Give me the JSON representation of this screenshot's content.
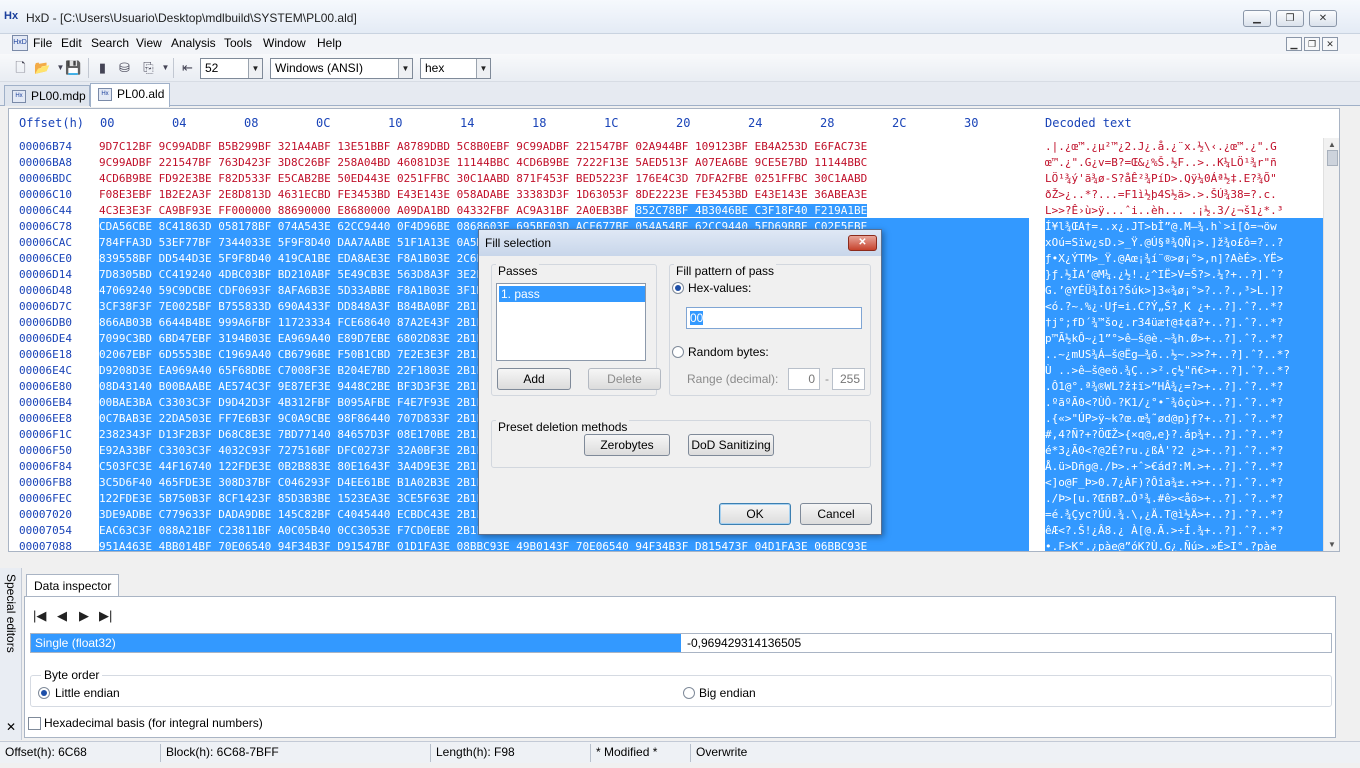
{
  "window": {
    "title": "HxD - [C:\\Users\\Usuario\\Desktop\\mdlbuild\\SYSTEM\\PL00.ald]",
    "icon_text": "Hx"
  },
  "menu": [
    "File",
    "Edit",
    "Search",
    "View",
    "Analysis",
    "Tools",
    "Window",
    "Help"
  ],
  "toolbar": {
    "bytes_per_row": "52",
    "charset": "Windows (ANSI)",
    "offset_base": "hex"
  },
  "tabs": [
    {
      "label": "PL00.mdp",
      "active": false
    },
    {
      "label": "PL00.ald",
      "active": true
    }
  ],
  "editor": {
    "offset_header": "Offset(h)",
    "columns": [
      "00",
      "04",
      "08",
      "0C",
      "10",
      "14",
      "18",
      "1C",
      "20",
      "24",
      "28",
      "2C",
      "30"
    ],
    "decoded_header": "Decoded text",
    "rows": [
      {
        "offset": "00006B74",
        "hex": "9D7C12BF 9C99ADBF B5B299BF 321A4ABF 13E51BBF A8789DBD 5C8B0EBF 9C99ADBF 221547BF 02A944BF 109123BF EB4A253D E6FAC73E",
        "text": ".|.¿œ™.¿µ²™¿2.J¿.å.¿¨x.½\\‹.¿œ™.¿\".G",
        "sel": "none"
      },
      {
        "offset": "00006BA8",
        "hex": "9C99ADBF 221547BF 763D423F 3D8C26BF 258A04BD 46081D3E 11144BBC 4CD6B9BE 7222F13E 5AED513F A07EA6BE 9CE5E7BD 11144BBC",
        "text": "œ™.¿\".G¿v=B?=Œ&¿%Š.½F..>..K¼LÖ¹¾r\"ñ",
        "sel": "none"
      },
      {
        "offset": "00006BDC",
        "hex": "4CD6B9BE FD92E3BE F82D533F E5CAB2BE 50ED443E 0251FFBC 30C1AABD 871F453F BED5223F 176E4C3D 7DFA2FBE 0251FFBC 30C1AABD",
        "text": "LÖ¹¾ý'ã¾ø-S?åÊ²¾PíD>.Qÿ¼0Áª½‡.E?¾Õ\"",
        "sel": "none"
      },
      {
        "offset": "00006C10",
        "hex": "F08E3EBF 1B2E2A3F 2E8D813D 4631ECBD FE3453BD E43E143E 058ADABE 33383D3F 1D63053F 8DE2223E FE3453BD E43E143E 36ABEA3E",
        "text": "ðŽ>¿..*?...=F1ì½þ4S½ä>.>.ŠÚ¾38=?.c.",
        "sel": "none"
      },
      {
        "offset": "00006C44",
        "hex": "4C3E3E3F CA9BF93E FF000000 88690000 E8680000 A09DA1BD 04332FBF AC9A31BF 2A0EB3BF 852C78BF 4B3046BE C3F18F40 F219A1BE",
        "text": "L>>?Ê›ù>ÿ...ˆi..èh... .¡½.3/¿¬š1¿*.³",
        "sel": "partial"
      },
      {
        "offset": "00006C78",
        "hex": "CDA56CBE 8C41863D 058178BF 074A543E 62CC9440 0F4D96BE 0868603E 695BF03D ACF677BF 054A54BE 62CC9440 5FD69BBE C02E5EBE",
        "text": "Í¥l¾ŒA†=..x¿.JT>bÌ”@.M–¾.h`>i[ð=¬öw",
        "sel": "full"
      },
      {
        "offset": "00006CAC",
        "hex": "784FFA3D 53EF77BF 7344033E 5F9F8D40 DAA7AABE 51F1A13E 0A5D9EBE 6FA3F43D 3F1B2E3F 0A82B33E 2B1F8D3F F54F08BF CBC2D9BC",
        "text": "xOú=Sïw¿sD.>_Ÿ.@Ú§ª¾QÑ¡>.]ž¾o£ô=?..?",
        "sel": "full"
      },
      {
        "offset": "00006CE0",
        "hex": "839558BF DD544D3E 5F9F8D40 419CA1BE EDA8AE3E F8A1B03E 2C6E5D3F 41E8C93E 0C59CB3E 1F8E6A3E 5B7E4E3F 4FD843BD 185570BF",
        "text": "ƒ•X¿ÝTM>_Ÿ.@Aœ¡¾í¨®>ø¡°>,n]?AèÉ>.YË>",
        "sel": "full"
      },
      {
        "offset": "00006D14",
        "hex": "7D8305BD CC419240 4DBC03BF BD210ABF 5E49CB3E 563D8A3F 3E2EBC3F 2B1F8D3F 5D0F883F 1B2E2A3F 8E6A3E5B 3F283EBF 0B54833D",
        "text": "}ƒ.½ÌA’@M¼.¿½!.¿^IË>V=Š?>.¼?+..?].ˆ?",
        "sel": "full"
      },
      {
        "offset": "00006D48",
        "hex": "47069240 59C9DCBE CDF0693F 8AFA6B3E 5D33ABBE F8A1B03E 3F1B2E3F 0A82B33E 4C0E5D3F 91E0C93E 7C59CB3E DF848ABF B84BA0BF",
        "text": "G.’@YÉÜ¾Íði?Šúk>]3«¾ø¡°>?..?.‚³>L.]?",
        "sel": "full"
      },
      {
        "offset": "00006D7C",
        "hex": "3CF38F3F 7E0025BF B755833D 690A433F DD848A3F B84BA0BF 2B1F8D3F 5D0F883F 1B2E2A3F 3F283EBF 0B54833D 8D288940 3FEEC9BE",
        "text": "<ó.?~.%¿·Uƒ=i.C?Ý„Š?¸K ¿+..?].ˆ?..*?",
        "sel": "full"
      },
      {
        "offset": "00006DB0",
        "hex": "866AB03B 6644B4BE 999A6FBF 11723334 FCE68640 87A2E43F 2B1F8D3F 5D0F883F 1B2E2A3F 3F283EBF 0B54833D BCF3B2BE 02A08633",
        "text": "†j°;fD´¾™šo¿.r34üæ†@‡¢ä?+..?].ˆ?..*?",
        "sel": "full"
      },
      {
        "offset": "00006DE4",
        "hex": "7099C3BD 6BD47EBF 3194B03E EA969A40 E89D7EBE 6802D83E 2B1F8D3F 5D0F883F 1B2E2A3F 3F283EBF 0B54833D 8A401C3D 4AB0F1BD",
        "text": "p™Ã½kÔ~¿1”°>ê–š@è.~¾h.Ø>+..?].ˆ?..*?",
        "sel": "full"
      },
      {
        "offset": "00006E18",
        "hex": "02067EBF 6D5553BE C1969A40 CB6796BE F50B1CBD 7E2E3E3F 2B1F8D3F 5D0F883F 1B2E2A3F 3F283EBF 0B54833D ECF1F3BD 4EA452BF",
        "text": "..~¿mUS¾Á–š@Ëg–¾õ..½~.>>?+..?].ˆ?..*?",
        "sel": "full"
      },
      {
        "offset": "00006E4C",
        "hex": "D9208D3E EA969A40 65F68DBE C7008F3E B204E7BD 22F1803E 2B1F8D3F 5D0F883F 1B2E2A3F 3F283EBF 0B54833D 9A1C74BF AF7D1FBE",
        "text": "Ù ..>ê–š@eö.¾Ç..>².ç½\"ñ€>+..?].ˆ?..*?",
        "sel": "full"
      },
      {
        "offset": "00006E80",
        "hex": "08D43140 B00BAABE AE574C3F 9E87EF3E 9448C2BE BF3D3F3E 2B1F8D3F 5D0F883F 1B2E2A3F 3F283EBF 0B54833D AE95AF3E F3355C40",
        "text": ".Ô1@°.ª¾®WL?ž‡ï>”HÂ¾¿=?>+..?].ˆ?..*?",
        "sel": "full"
      },
      {
        "offset": "00006EB4",
        "hex": "00BAE3BA C3303C3F D9D42D3F 4B312FBF B095AFBE F4E7F93E 2B1F8D3F 5D0F883F 1B2E2A3F 3F283EBF 0B54833D 98F86440 702D833F",
        "text": ".ºãºÃ0<?ÙÔ-?K1/¿°•¯¾ôçù>+..?].ˆ?..*?",
        "sel": "full"
      },
      {
        "offset": "00006EE8",
        "hex": "0C7BAB3E 22DA503E FF7E6B3F 9C0A9CBE 98F86440 707D833F 2B1F8D3F 5D0F883F 1B2E2A3F 3F283EBF 0B54833D 84657D3F 07E170BE",
        "text": ".{«>\"ÚP>ÿ~k?œ.œ¾˜ød@p}ƒ?+..?].ˆ?..*?",
        "sel": "full"
      },
      {
        "offset": "00006F1C",
        "hex": "2382343F D13F2B3F D68C8E3E 7BD77140 84657D3F 08E170BE 2B1F8D3F 5D0F883F 1B2E2A3F 3F283EBF 0B54833D 18E924BF 1BFB9DBE",
        "text": "#‚4?Ñ?+?ÖŒŽ>{×q@„e}?.áp¾+..?].ˆ?..*?",
        "sel": "full"
      },
      {
        "offset": "00006F50",
        "hex": "E92A33BF C3303C3F 4032C93F 727516BF DFC0273F 32A0BF3E 2B1F8D3F 5D0F883F 1B2E2A3F 3F283EBF 0B54833D 7BE1643F 408BB8BE",
        "text": "é*3¿Ã0<?@2É?ru.¿ßÀ'?2 ¿>+..?].ˆ?..*?",
        "sel": "full"
      },
      {
        "offset": "00006F84",
        "hex": "C503FC3E 44F16740 122FDE3E 0B2B883E 80E1643F 3A4D9E3E 2B1F8D3F 5D0F883F 1B2E2A3F 3F283EBF 0B54833D 456662BE 2D74C4BE",
        "text": "Å.ü>Dñg@./Þ>.+ˆ>€ád?:M.>+..?].ˆ?..*?",
        "sel": "full"
      },
      {
        "offset": "00006FB8",
        "hex": "3C5D6F40 465FDE3E 308D37BF C046293F D4EE61BE B1A02B3E 2B1F8D3F 5D0F883F 1B2E2A3F 3F283EBF 0B54833D B147243F F4726640",
        "text": "<]o@F_Þ>0.7¿ÀF)?Ôîa¾±.+>+..?].ˆ?..*?",
        "sel": "full"
      },
      {
        "offset": "00006FEC",
        "hex": "122FDE3E 5B750B3F 8CF1423F 85D3B3BE 1523EA3E 3CE5F63E 2B1F8D3F 5D0F883F 1B2E2A3F 3F283EBF 0B54833D 3C5D6F40 465FDE3E",
        "text": "./Þ>[u.?ŒñB?…Ó³¾.#ê><åö>+..?].ˆ?..*?",
        "sel": "full"
      },
      {
        "offset": "00007020",
        "hex": "3DE9ADBE C779633F DADA9DBE 145C82BF C4045440 ECBDC43E 2B1F8D3F 5D0F883F 1B2E2A3F 3F283EBF 0B54833D EC8D253E 89B7763E",
        "text": "=é.¾Çyc?ÚÚ.¾.\\‚¿Ä.T@ì½Ä>+..?].ˆ?..*?",
        "sel": "full"
      },
      {
        "offset": "00007054",
        "hex": "EAC63C3F 088A21BF C23811BF A0C05B40 0CC3053E F7CD0EBE 2B1F8D3F 5D0F883F 1B2E2A3F 3F283EBF 0B54833D 2BD5F13E 4F245C3F",
        "text": "êÆ<?.Š!¿Â8.¿ À[@.Ã.>÷Í.¾+..?].ˆ?..*?",
        "sel": "full"
      },
      {
        "offset": "00007088",
        "hex": "951A463E 4BB014BF 70E06540 94F34B3F D91547BF 01D1FA3E 08BBC93E 49B0143F 70E06540 94F34B3F D815473F 04D1FA3E 06BBC93E",
        "text": "•.F>K°.¿pàe@”óK?Ù.G¿.Ñú>.»É>I°.?pàe",
        "sel": "full"
      }
    ]
  },
  "dialog": {
    "title": "Fill selection",
    "close_label": "✕",
    "passes_label": "Passes",
    "passes": [
      "1. pass"
    ],
    "add_label": "Add",
    "delete_label": "Delete",
    "pattern_label": "Fill pattern of pass",
    "hex_values_label": "Hex-values:",
    "hex_value": "00",
    "random_label": "Random bytes:",
    "range_label": "Range (decimal):",
    "range_min": "0",
    "range_sep": "-",
    "range_max": "255",
    "preset_label": "Preset deletion methods",
    "zerobytes_label": "Zerobytes",
    "dod_label": "DoD Sanitizing",
    "ok_label": "OK",
    "cancel_label": "Cancel"
  },
  "inspector": {
    "side_label": "Special editors",
    "tab_label": "Data inspector",
    "nav": [
      "|◀",
      "◀",
      "▶",
      "▶|"
    ],
    "field_name": "Single (float32)",
    "field_value": "-0,969429314136505",
    "byte_order_label": "Byte order",
    "little_endian": "Little endian",
    "big_endian": "Big endian",
    "hex_basis": "Hexadecimal basis (for integral numbers)"
  },
  "status": {
    "offset": "Offset(h): 6C68",
    "block": "Block(h): 6C68-7BFF",
    "length": "Length(h): F98",
    "modified": "* Modified *",
    "mode": "Overwrite"
  }
}
